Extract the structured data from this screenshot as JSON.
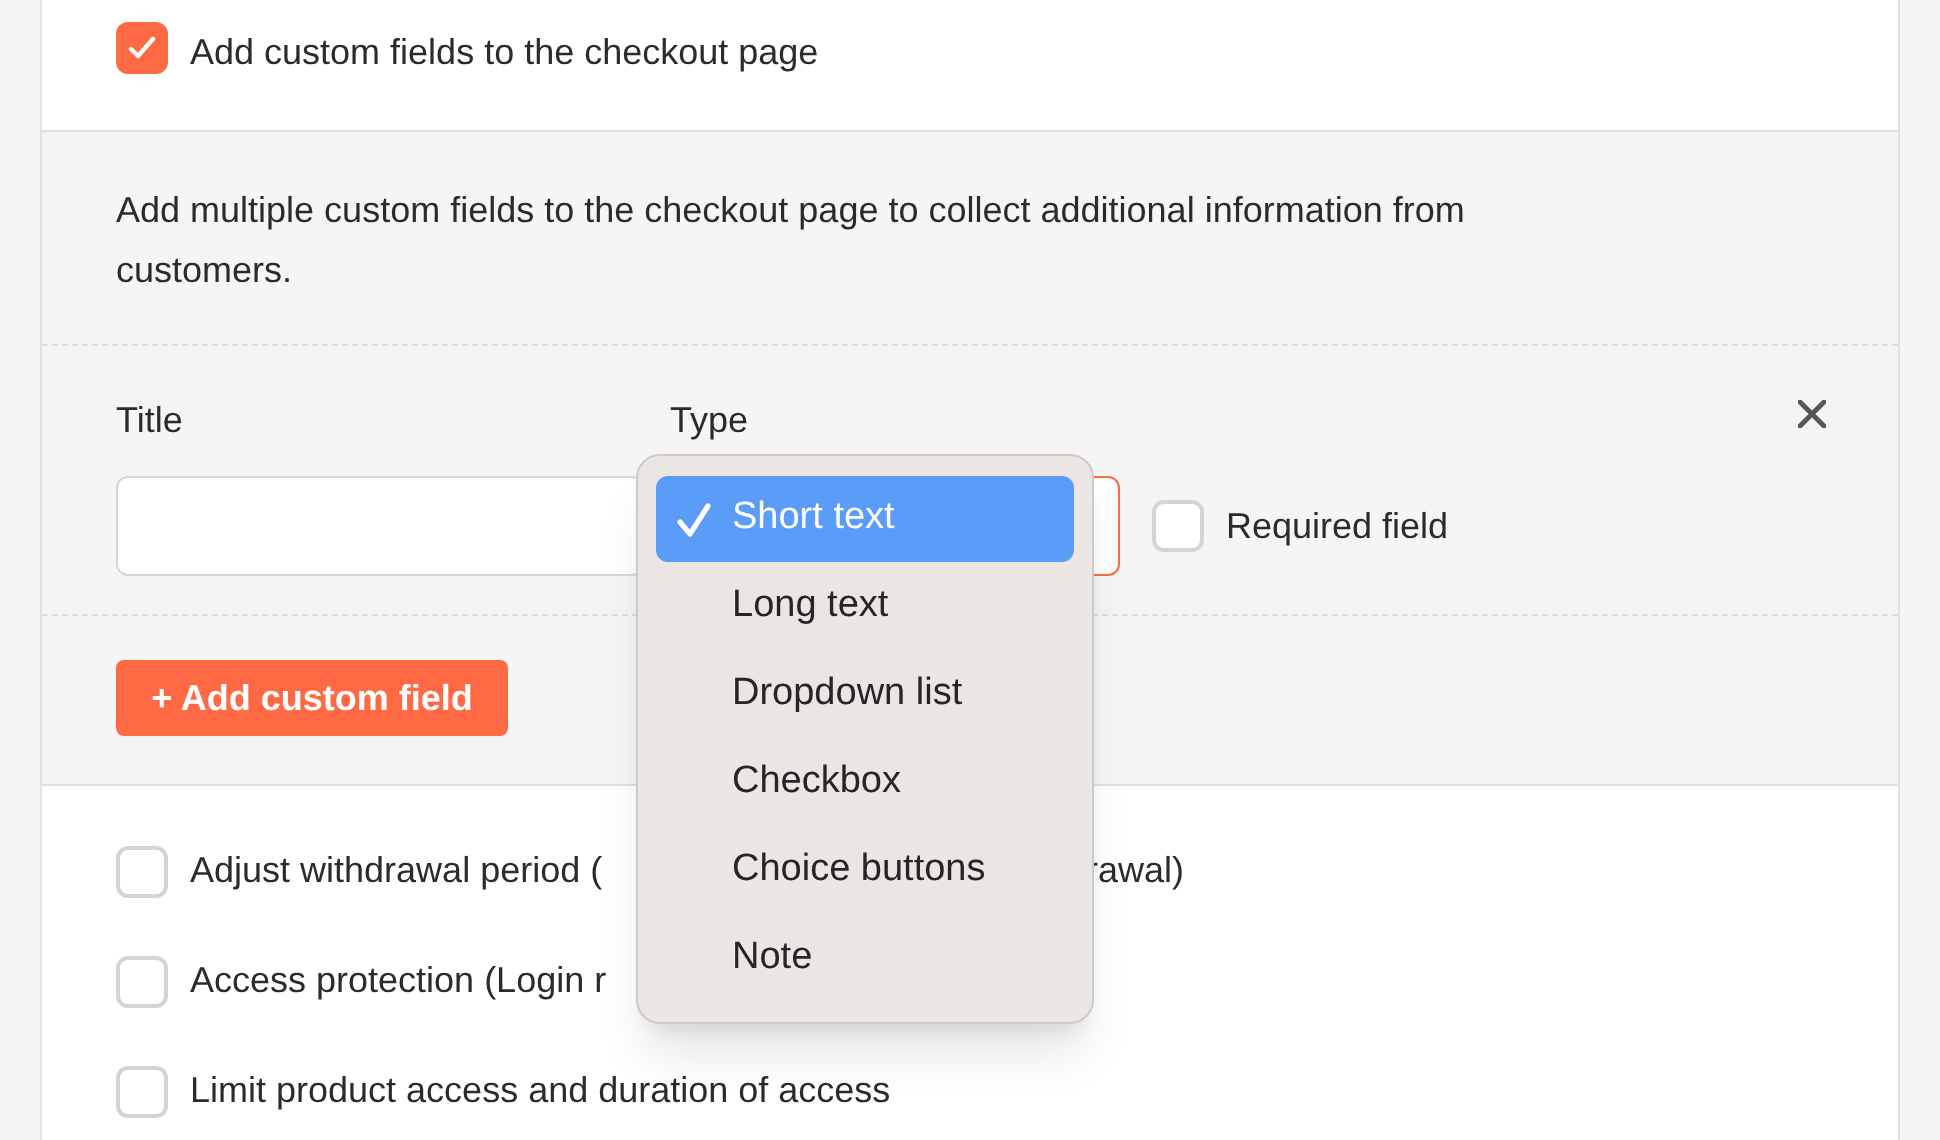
{
  "custom_fields_option": {
    "label": "Add custom fields to the checkout page",
    "checked": true
  },
  "description": "Add multiple custom fields to the checkout page to collect additional information from customers.",
  "field_row": {
    "title_label": "Title",
    "type_label": "Type",
    "required": {
      "label": "Required field",
      "checked": false
    }
  },
  "add_button": "+ Add custom field",
  "options": [
    {
      "label": "Adjust withdrawal period (",
      "label_tail": "rawal)",
      "checked": false
    },
    {
      "label": "Access protection (Login r",
      "checked": false
    },
    {
      "label": "Limit product access and duration of access",
      "checked": false
    }
  ],
  "type_menu": [
    {
      "label": "Short text",
      "selected": true
    },
    {
      "label": "Long text",
      "selected": false
    },
    {
      "label": "Dropdown list",
      "selected": false
    },
    {
      "label": "Checkbox",
      "selected": false
    },
    {
      "label": "Choice buttons",
      "selected": false
    },
    {
      "label": "Note",
      "selected": false
    }
  ]
}
